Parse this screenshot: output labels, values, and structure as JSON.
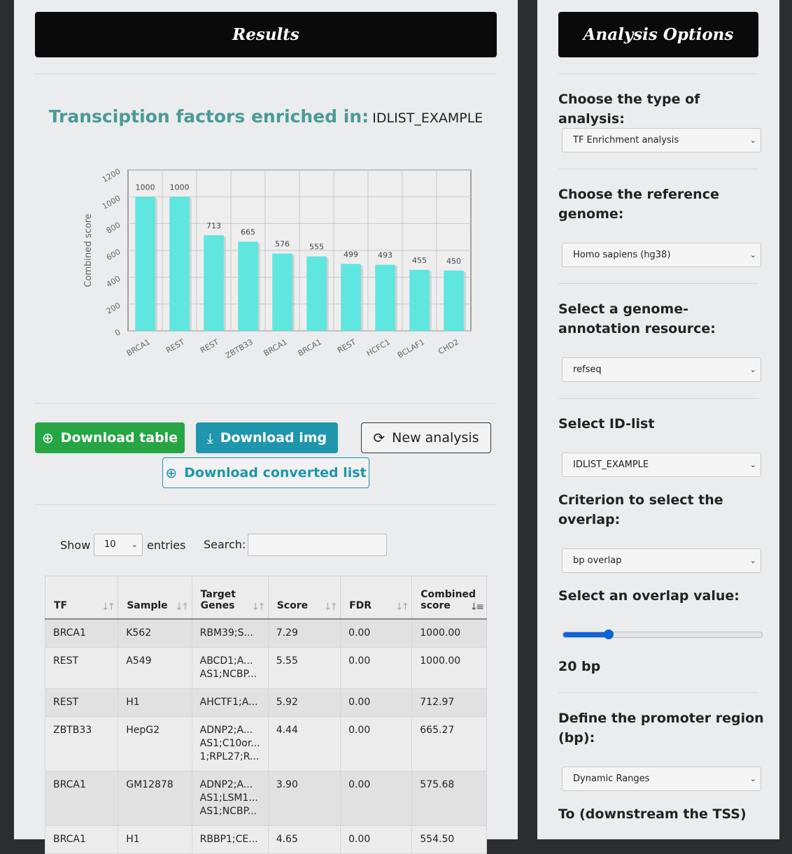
{
  "results": {
    "title": "Results",
    "chart_heading": "Transciption factors enriched in:",
    "id_list": "IDLIST_EXAMPLE",
    "buttons": {
      "download_table": "Download table",
      "download_img": "Download img",
      "new_analysis": "New analysis",
      "download_converted": "Download converted list"
    },
    "show_label": "Show",
    "entries_value": "10",
    "entries_label": "entries",
    "search_label": "Search:",
    "search_value": "",
    "table": {
      "columns": [
        "TF",
        "Sample",
        "Target\nGenes",
        "Score",
        "FDR",
        "Combined\nscore"
      ],
      "rows": [
        [
          "BRCA1",
          "K562",
          "RBM39;S...",
          "7.29",
          "0.00",
          "1000.00"
        ],
        [
          "REST",
          "A549",
          "ABCD1;A...\nAS1;NCBP...",
          "5.55",
          "0.00",
          "1000.00"
        ],
        [
          "REST",
          "H1",
          "AHCTF1;A...",
          "5.92",
          "0.00",
          "712.97"
        ],
        [
          "ZBTB33",
          "HepG2",
          "ADNP2;A...\nAS1;C10or...\n1;RPL27;R...",
          "4.44",
          "0.00",
          "665.27"
        ],
        [
          "BRCA1",
          "GM12878",
          "ADNP2;A...\nAS1;LSM1...\nAS1;NCBP...",
          "3.90",
          "0.00",
          "575.68"
        ],
        [
          "BRCA1",
          "H1",
          "RBBP1;CE...",
          "4.65",
          "0.00",
          "554.50"
        ]
      ]
    }
  },
  "chart_data": {
    "type": "bar",
    "categories": [
      "BRCA1",
      "REST",
      "REST",
      "ZBTB33",
      "BRCA1",
      "BRCA1",
      "REST",
      "HCFC1",
      "BCLAF1",
      "CHD2"
    ],
    "values": [
      1000,
      1000,
      713,
      665,
      576,
      555,
      499,
      493,
      455,
      450
    ],
    "ylabel": "Combined score",
    "ylim": [
      0,
      1200
    ],
    "yticks": [
      0,
      200,
      400,
      600,
      800,
      1000,
      1200
    ],
    "grid": true,
    "bar_color": "#5ee6df"
  },
  "options": {
    "title": "Analysis Options",
    "analysis_type_label": "Choose the type of analysis:",
    "analysis_type_value": "TF Enrichment analysis",
    "genome_label": "Choose the reference genome:",
    "genome_value": "Homo sapiens (hg38)",
    "annotation_label": "Select a genome-annotation resource:",
    "annotation_value": "refseq",
    "idlist_label": "Select ID-list",
    "idlist_value": "IDLIST_EXAMPLE",
    "criterion_label": "Criterion to select the overlap:",
    "criterion_value": "bp overlap",
    "overlap_label": "Select an overlap value:",
    "overlap_fraction": 0.23,
    "overlap_value_text": "20 bp",
    "promoter_label": "Define the promoter region (bp):",
    "promoter_value": "Dynamic Ranges",
    "downstream_label": "To (downstream the TSS)"
  }
}
